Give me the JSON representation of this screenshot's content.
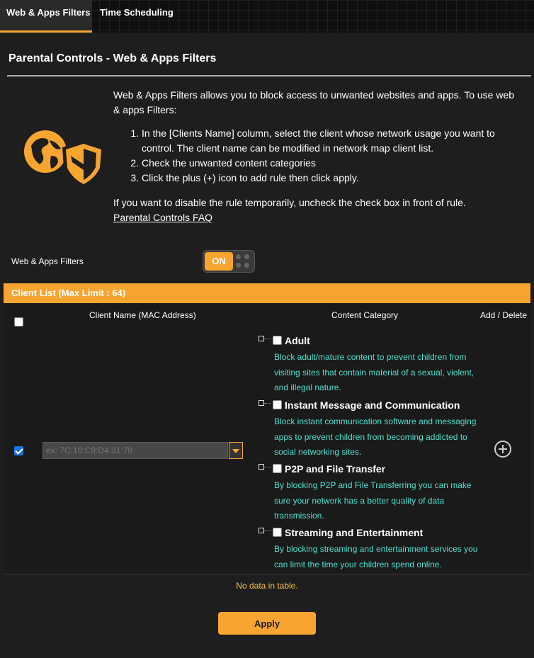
{
  "tabs": [
    {
      "label": "Web & Apps Filters",
      "active": true
    },
    {
      "label": "Time Scheduling",
      "active": false
    }
  ],
  "page": {
    "title": "Parental Controls - Web & Apps Filters",
    "intro": "Web & Apps Filters allows you to block access to unwanted websites and apps. To use web & apps Filters:",
    "steps": [
      "In the [Clients Name] column, select the client whose network usage you want to control. The client name can be modified in network map client list.",
      "Check the unwanted content categories",
      "Click the plus (+) icon to add rule then click apply."
    ],
    "note": "If you want to disable the rule temporarily, uncheck the check box in front of rule.",
    "faq_link": "Parental Controls FAQ"
  },
  "filter_toggle": {
    "label": "Web & Apps Filters",
    "state": "ON"
  },
  "client_list": {
    "header": "Client List (Max Limit : 64)",
    "columns": {
      "name": "Client Name (MAC Address)",
      "category": "Content Category",
      "action": "Add / Delete"
    },
    "mac_placeholder": "ex: 7C:10:C9:D4:31:78",
    "categories": [
      {
        "title": "Adult",
        "desc": "Block adult/mature content to prevent children from visiting sites that contain material of a sexual, violent, and illegal nature."
      },
      {
        "title": "Instant Message and Communication",
        "desc": "Block instant communication software and messaging apps to prevent children from becoming addicted to social networking sites."
      },
      {
        "title": "P2P and File Transfer",
        "desc": "By blocking P2P and File Transferring you can make sure your network has a better quality of data transmission."
      },
      {
        "title": "Streaming and Entertainment",
        "desc": "By blocking streaming and entertainment services you can limit the time your children spend online."
      }
    ],
    "empty_text": "No data in table."
  },
  "apply_label": "Apply",
  "colors": {
    "accent": "#f7a530",
    "desc_text": "#4fe0d0"
  }
}
